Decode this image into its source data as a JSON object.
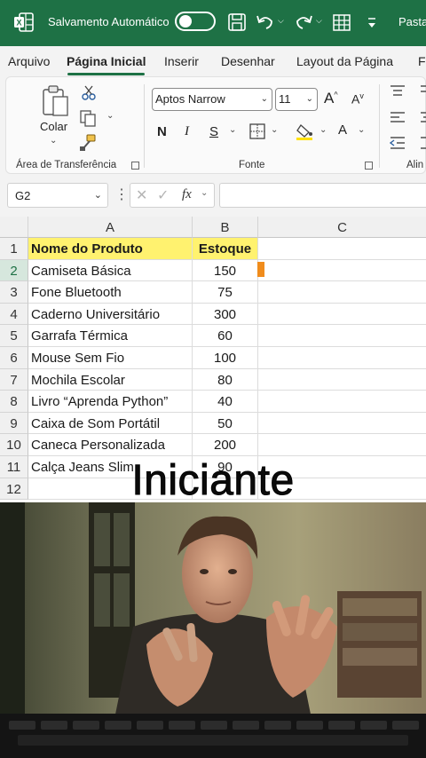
{
  "titlebar": {
    "autosave_label": "Salvamento Automático",
    "file_title": "Pasta",
    "bg_color": "#1e7145"
  },
  "tabs": [
    {
      "label": "Arquivo"
    },
    {
      "label": "Página Inicial",
      "active": true
    },
    {
      "label": "Inserir"
    },
    {
      "label": "Desenhar"
    },
    {
      "label": "Layout da Página"
    },
    {
      "label": "F"
    }
  ],
  "ribbon": {
    "clipboard": {
      "paste_label": "Colar",
      "group_label": "Área de Transferência"
    },
    "font": {
      "family": "Aptos Narrow",
      "size": "11",
      "bold": "N",
      "italic": "I",
      "underline": "S",
      "color_letter": "A",
      "group_label": "Fonte"
    },
    "alignment": {
      "group_label": "Alin"
    }
  },
  "formula_bar": {
    "name_box": "G2",
    "fx_label": "fx",
    "formula": ""
  },
  "sheet": {
    "columns": [
      "A",
      "B",
      "C"
    ],
    "rows": [
      {
        "n": "1",
        "a": "Nome do Produto",
        "b": "Estoque"
      },
      {
        "n": "2",
        "a": "Camiseta Básica",
        "b": "150"
      },
      {
        "n": "3",
        "a": "Fone Bluetooth",
        "b": "75"
      },
      {
        "n": "4",
        "a": "Caderno Universitário",
        "b": "300"
      },
      {
        "n": "5",
        "a": "Garrafa Térmica",
        "b": "60"
      },
      {
        "n": "6",
        "a": "Mouse Sem Fio",
        "b": "100"
      },
      {
        "n": "7",
        "a": "Mochila Escolar",
        "b": "80"
      },
      {
        "n": "8",
        "a": "Livro “Aprenda Python”",
        "b": "40"
      },
      {
        "n": "9",
        "a": "Caixa de Som Portátil",
        "b": "50"
      },
      {
        "n": "10",
        "a": "Caneca Personalizada",
        "b": "200"
      },
      {
        "n": "11",
        "a": "Calça Jeans Slim",
        "b": "90"
      },
      {
        "n": "12",
        "a": "",
        "b": ""
      }
    ],
    "header_highlight": "#fff26f",
    "selected_row": "2"
  },
  "overlay": {
    "caption": "Iniciante"
  }
}
